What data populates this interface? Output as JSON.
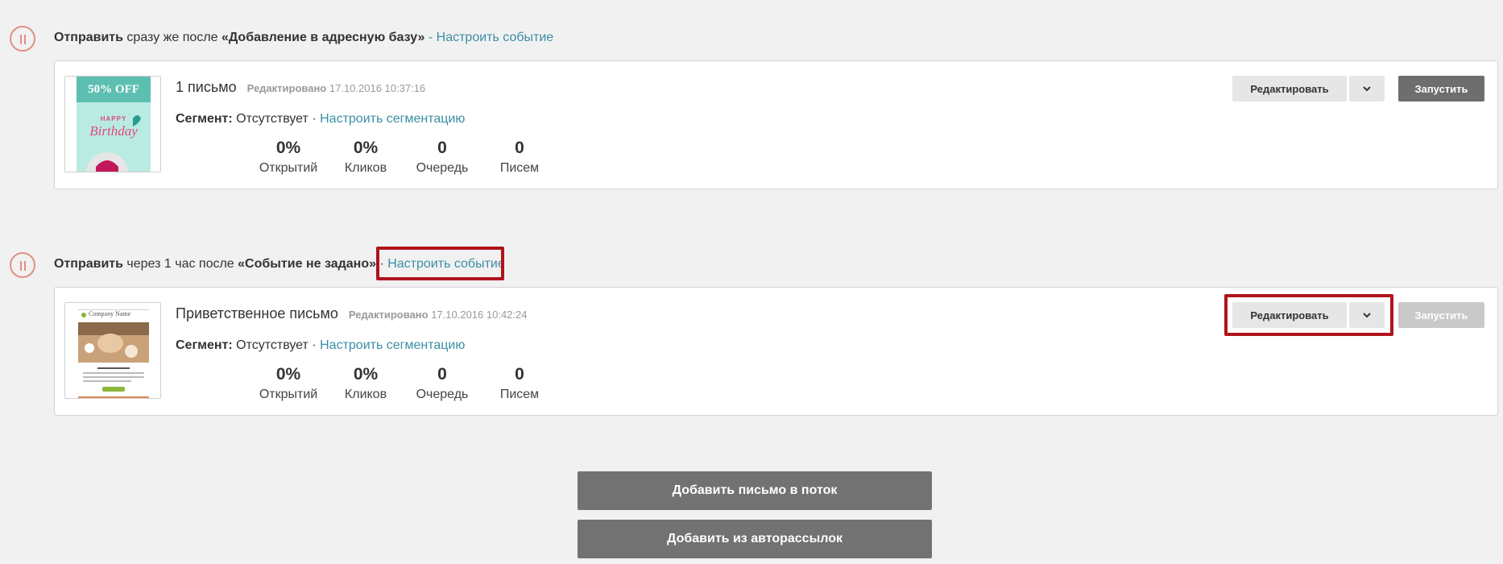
{
  "steps": [
    {
      "send_label": "Отправить",
      "timing": "сразу же после",
      "event": "«Добавление в адресную базу»",
      "separator": "-",
      "configure_event": "Настроить событие",
      "mail": {
        "title": "1 письмо",
        "edited_label": "Редактировано",
        "edited_date": "17.10.2016 10:37:16",
        "segment_label": "Сегмент:",
        "segment_value": "Отсутствует",
        "segment_sep": "·",
        "segment_link": "Настроить сегментацию",
        "thumb_headline": "50% OFF",
        "thumb_sub": "HAPPY",
        "thumb_script": "Birthday",
        "stats": [
          {
            "value": "0%",
            "label": "Открытий"
          },
          {
            "value": "0%",
            "label": "Кликов"
          },
          {
            "value": "0",
            "label": "Очередь"
          },
          {
            "value": "0",
            "label": "Писем"
          }
        ],
        "edit_button": "Редактировать",
        "run_button": "Запустить"
      }
    },
    {
      "send_label": "Отправить",
      "timing": "через 1 час после",
      "event": "«Событие не задано»",
      "separator": "·",
      "configure_event": "Настроить событие",
      "mail": {
        "title": "Приветственное письмо",
        "edited_label": "Редактировано",
        "edited_date": "17.10.2016 10:42:24",
        "segment_label": "Сегмент:",
        "segment_value": "Отсутствует",
        "segment_sep": "·",
        "segment_link": "Настроить сегментацию",
        "thumb_company": "Company Name",
        "stats": [
          {
            "value": "0%",
            "label": "Открытий"
          },
          {
            "value": "0%",
            "label": "Кликов"
          },
          {
            "value": "0",
            "label": "Очередь"
          },
          {
            "value": "0",
            "label": "Писем"
          }
        ],
        "edit_button": "Редактировать",
        "run_button": "Запустить"
      }
    }
  ],
  "actions": {
    "add_to_flow": "Добавить письмо в поток",
    "add_from_auto": "Добавить из авторассылок"
  },
  "colors": {
    "link": "#3b8ea5",
    "pause_icon": "#e08f84",
    "highlight": "#b0141c",
    "dark_button": "#727272"
  }
}
